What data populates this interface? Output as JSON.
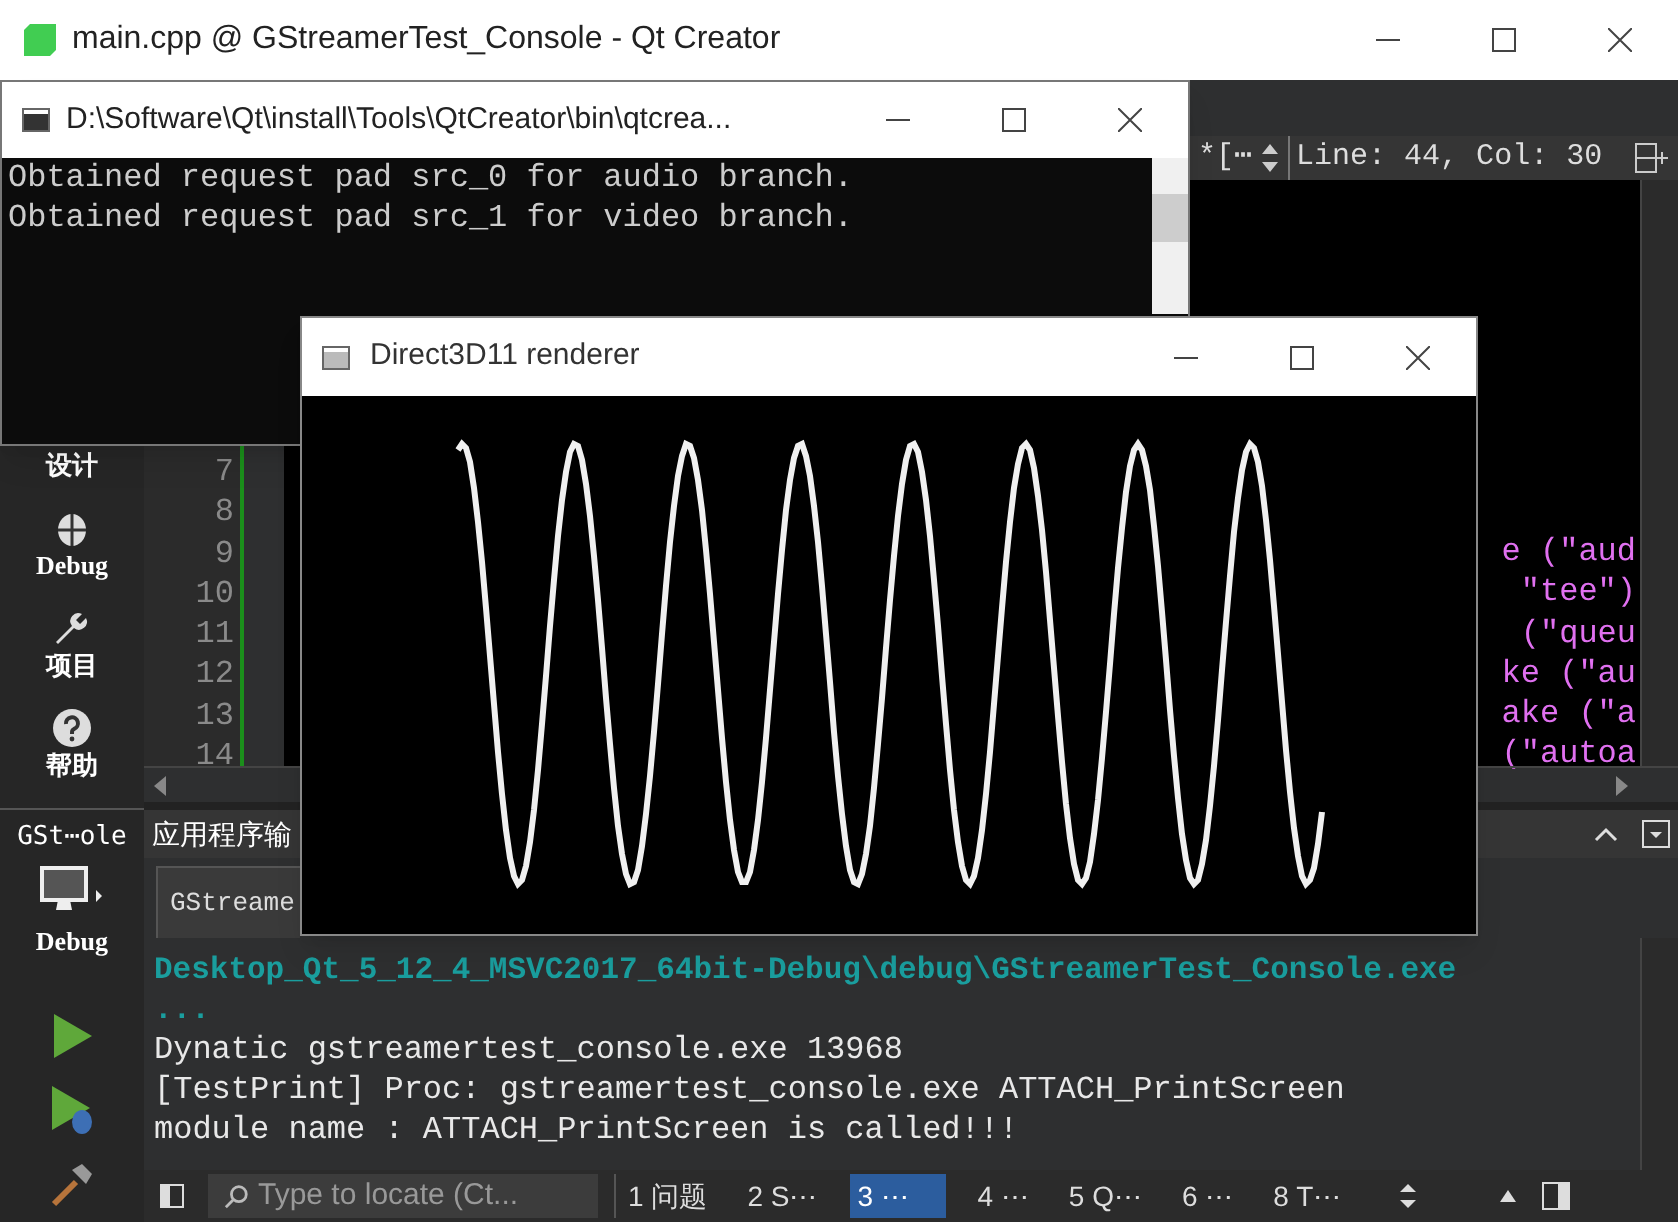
{
  "main_window": {
    "title": "main.cpp @ GStreamerTest_Console - Qt Creator"
  },
  "editor": {
    "document_indicator": "*[⋯",
    "position": "Line: 44, Col: 30",
    "line_numbers": [
      "7",
      "8",
      "9",
      "10",
      "11",
      "12",
      "13",
      "14"
    ],
    "code_fragments": [
      "e (\"aud",
      "\"tee\")",
      "(\"queu",
      "ke (\"au",
      "ake (\"a",
      "(\"autoa"
    ]
  },
  "mode_bar": {
    "items": [
      {
        "label": "设计",
        "kind": "design"
      },
      {
        "label": "Debug",
        "kind": "debug"
      },
      {
        "label": "项目",
        "kind": "projects"
      },
      {
        "label": "帮助",
        "kind": "help"
      }
    ]
  },
  "kit_selector": {
    "project": "GSt⋯ole",
    "build": "Debug"
  },
  "output_pane": {
    "title": "应用程序输",
    "tab": "GStreame",
    "lines": [
      {
        "text": "Desktop_Qt_5_12_4_MSVC2017_64bit-Debug\\debug\\GStreamerTest_Console.exe",
        "kind": "path"
      },
      {
        "text": "...",
        "kind": "path"
      },
      {
        "text": "Dynatic gstreamertest_console.exe 13968",
        "kind": "normal"
      },
      {
        "text": "[TestPrint] Proc: gstreamertest_console.exe ATTACH_PrintScreen",
        "kind": "normal"
      },
      {
        "text": "module name : ATTACH_PrintScreen is called!!!",
        "kind": "normal"
      }
    ]
  },
  "status_bar": {
    "search": {
      "placeholder": "Type to locate (Ct..."
    },
    "tabs": [
      {
        "label": "1 问题",
        "selected": false
      },
      {
        "label": "2 S⋯",
        "selected": false
      },
      {
        "label": "3 ⋯",
        "selected": true
      },
      {
        "label": "4 ⋯",
        "selected": false
      },
      {
        "label": "5 Q⋯",
        "selected": false
      },
      {
        "label": "6 ⋯",
        "selected": false
      },
      {
        "label": "8 T⋯",
        "selected": false
      }
    ]
  },
  "console_window": {
    "title": "D:\\Software\\Qt\\install\\Tools\\QtCreator\\bin\\qtcrea...",
    "lines": [
      "Obtained request pad src_0 for audio branch.",
      "Obtained request pad src_1 for video branch."
    ]
  },
  "renderer_window": {
    "title": "Direct3D11 renderer"
  }
}
